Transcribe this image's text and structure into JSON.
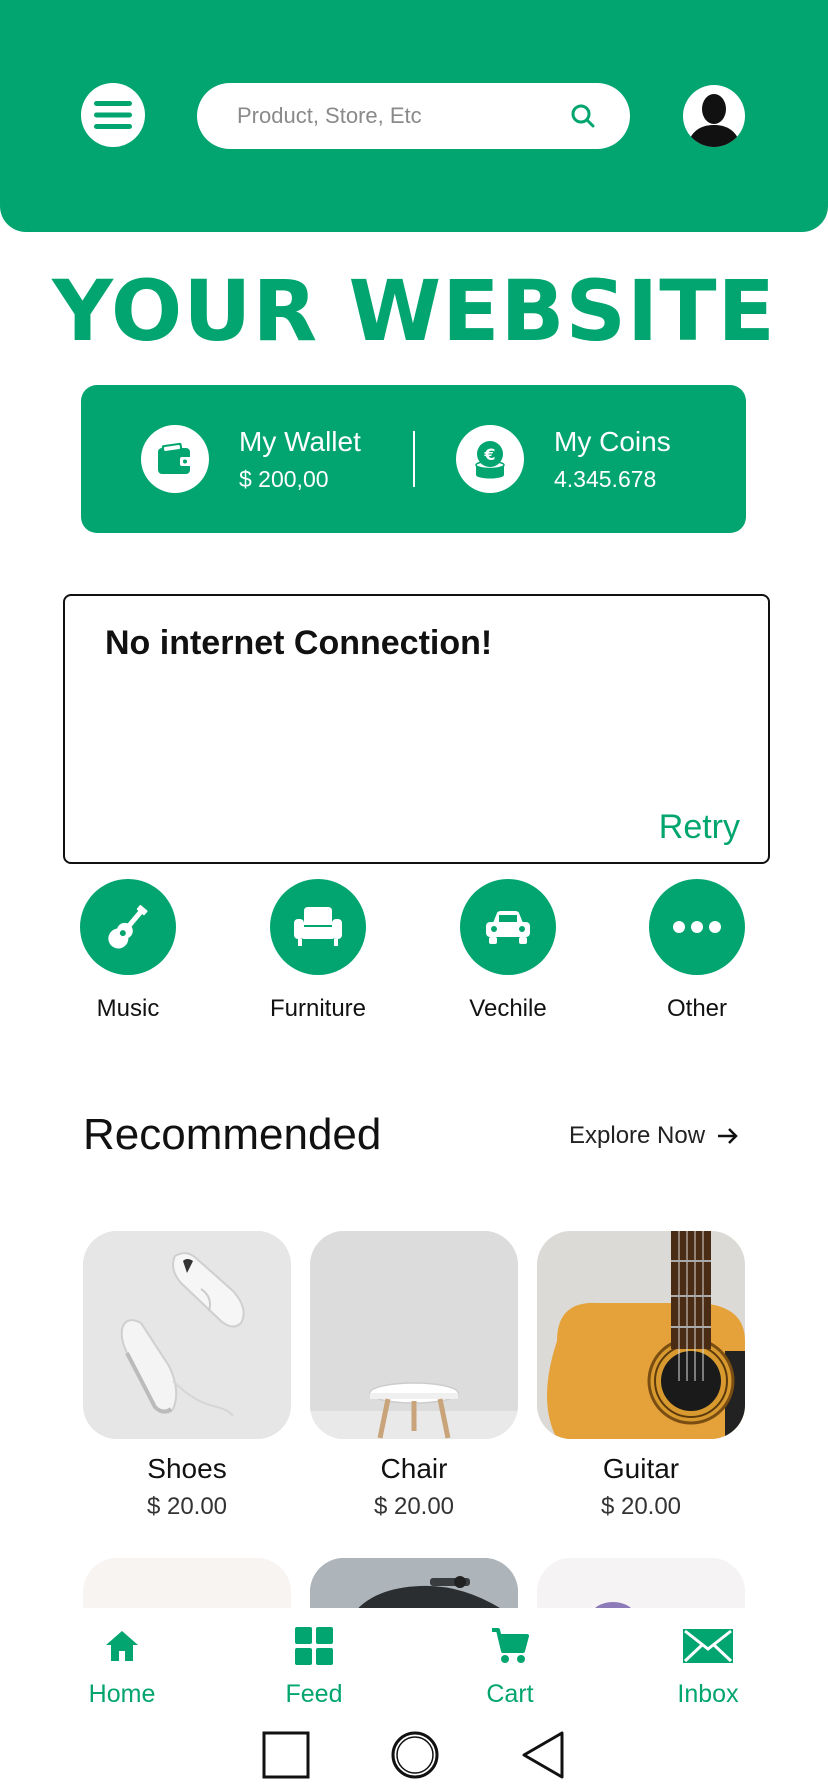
{
  "header": {
    "search_placeholder": "Product, Store, Etc",
    "menu_icon": "hamburger-icon",
    "search_icon": "search-icon",
    "avatar_icon": "user-avatar"
  },
  "title": "YOUR WEBSITE",
  "wallet": {
    "label": "My Wallet",
    "value": "$ 200,00",
    "icon": "wallet-icon"
  },
  "coins": {
    "label": "My Coins",
    "value": "4.345.678",
    "icon": "coins-icon"
  },
  "alert": {
    "message": "No internet Connection!",
    "retry_label": "Retry"
  },
  "categories": [
    {
      "label": "Music",
      "icon": "guitar-icon"
    },
    {
      "label": "Furniture",
      "icon": "armchair-icon"
    },
    {
      "label": "Vechile",
      "icon": "car-icon"
    },
    {
      "label": "Other",
      "icon": "more-icon"
    }
  ],
  "recommended": {
    "title": "Recommended",
    "explore_label": "Explore Now"
  },
  "products": [
    {
      "name": "Shoes",
      "price": "$ 20.00"
    },
    {
      "name": "Chair",
      "price": "$ 20.00"
    },
    {
      "name": "Guitar",
      "price": "$ 20.00"
    }
  ],
  "bottom_nav": [
    {
      "label": "Home",
      "icon": "home-icon"
    },
    {
      "label": "Feed",
      "icon": "grid-icon"
    },
    {
      "label": "Cart",
      "icon": "cart-icon"
    },
    {
      "label": "Inbox",
      "icon": "mail-icon"
    }
  ],
  "colors": {
    "brand": "#02a56f"
  }
}
